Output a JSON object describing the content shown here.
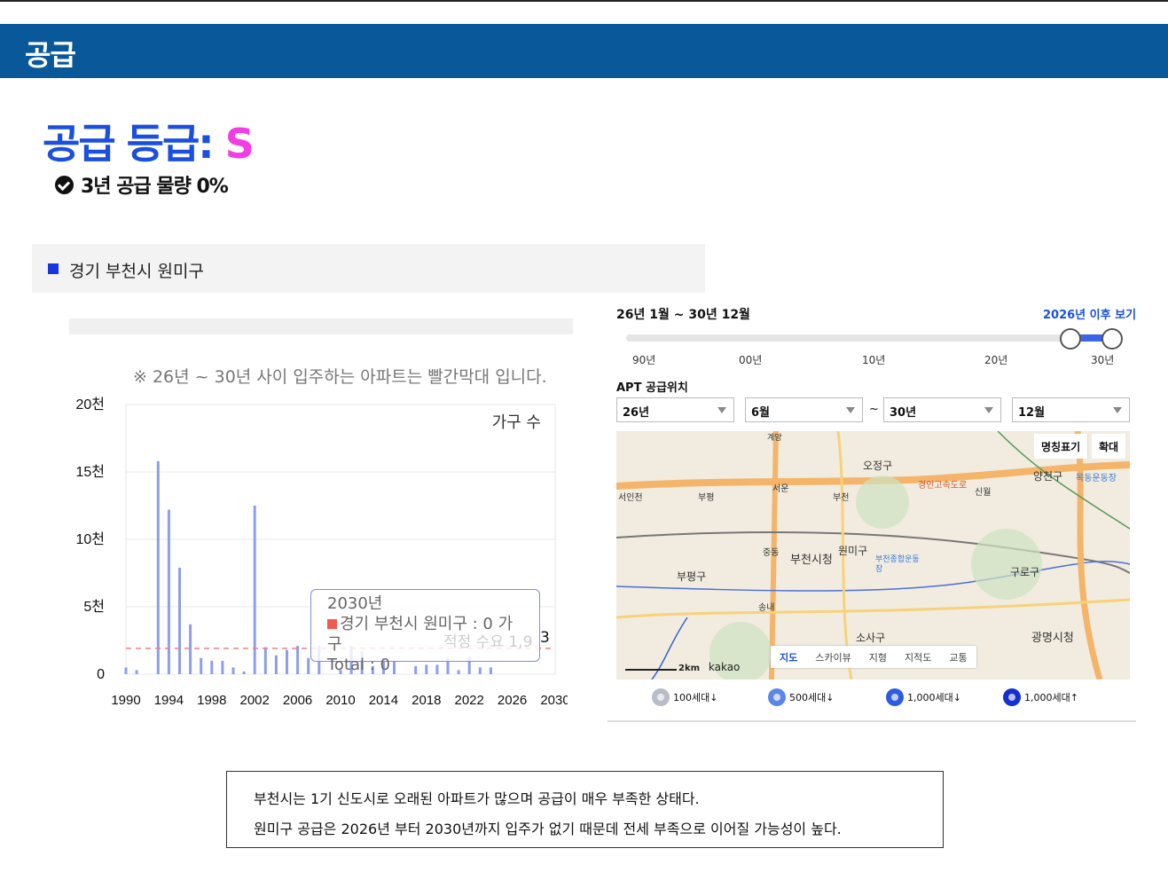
{
  "header": {
    "title": "공급"
  },
  "grade": {
    "label": "공급 등급: ",
    "value": "S"
  },
  "supply_volume": "3년 공급 물량 0%",
  "region": "경기 부천시 원미구",
  "chart": {
    "note": "※ 26년 ~ 30년 사이 입주하는 아파트는 빨간막대 입니다.",
    "legend_label": "가구 수",
    "tooltip_title": "2030년",
    "tooltip_line": "경기 부천시 원미구 : 0 가구",
    "tooltip_total": "Total : 0",
    "overlay_label": "적정 수요 1,9",
    "overlay_suffix": "3"
  },
  "chart_data": {
    "type": "bar",
    "categories": [
      "1990",
      "1991",
      "1992",
      "1993",
      "1994",
      "1995",
      "1996",
      "1997",
      "1998",
      "1999",
      "2000",
      "2001",
      "2002",
      "2003",
      "2004",
      "2005",
      "2006",
      "2007",
      "2008",
      "2009",
      "2010",
      "2011",
      "2012",
      "2013",
      "2014",
      "2015",
      "2016",
      "2017",
      "2018",
      "2019",
      "2020",
      "2021",
      "2022",
      "2023",
      "2024",
      "2025",
      "2026",
      "2027",
      "2028",
      "2029",
      "2030"
    ],
    "values": [
      500,
      300,
      0,
      15800,
      12200,
      7900,
      3700,
      1200,
      1000,
      1000,
      500,
      200,
      12500,
      2000,
      1400,
      1800,
      2100,
      1200,
      2100,
      0,
      300,
      2100,
      1700,
      600,
      1200,
      1000,
      0,
      600,
      700,
      700,
      1200,
      300,
      1300,
      500,
      500,
      0,
      0,
      0,
      0,
      0,
      0
    ],
    "y_ticks": [
      "0",
      "5천",
      "10천",
      "15천",
      "20천"
    ],
    "x_ticks": [
      "1990",
      "1994",
      "1998",
      "2002",
      "2006",
      "2010",
      "2014",
      "2018",
      "2022",
      "2026",
      "2030"
    ],
    "ylim": [
      0,
      20000
    ],
    "demand_line": 1913,
    "bar_color": "#8b9ef0",
    "demand_color": "#f08080"
  },
  "map_panel": {
    "period": "26년 1월 ~ 30년 12월",
    "after_link": "2026년 이후 보기",
    "slider_ticks": [
      "90년",
      "00년",
      "10년",
      "20년",
      "30년"
    ],
    "apt_label": "APT 공급위치",
    "selects": [
      "26년",
      "6월",
      "30년",
      "12월"
    ],
    "tilde": "~",
    "map_buttons": [
      "명칭표기",
      "확대"
    ],
    "map_types": [
      "지도",
      "스카이뷰",
      "지형",
      "지적도",
      "교통"
    ],
    "scale": "2km",
    "provider": "kakao",
    "labels": [
      "오정구",
      "양천구",
      "목동운동장",
      "서인천",
      "부평",
      "서운",
      "부천",
      "신월",
      "경인고속도로",
      "중동",
      "부천시청",
      "원미구",
      "부천종합운동장",
      "부평구",
      "구로구",
      "송내",
      "소사구",
      "광명시청",
      "계양"
    ],
    "legend": [
      "100세대↓",
      "500세대↓",
      "1,000세대↓",
      "1,000세대↑"
    ],
    "legend_colors": [
      "#b8bdc8",
      "#5b86e8",
      "#2e5ce0",
      "#1530d0"
    ]
  },
  "summary": [
    "부천시는 1기 신도시로 오래된 아파트가 많으며 공급이 매우 부족한 상태다.",
    "원미구 공급은 2026년 부터 2030년까지 입주가 없기 때문데 전세 부족으로 이어질 가능성이 높다."
  ]
}
